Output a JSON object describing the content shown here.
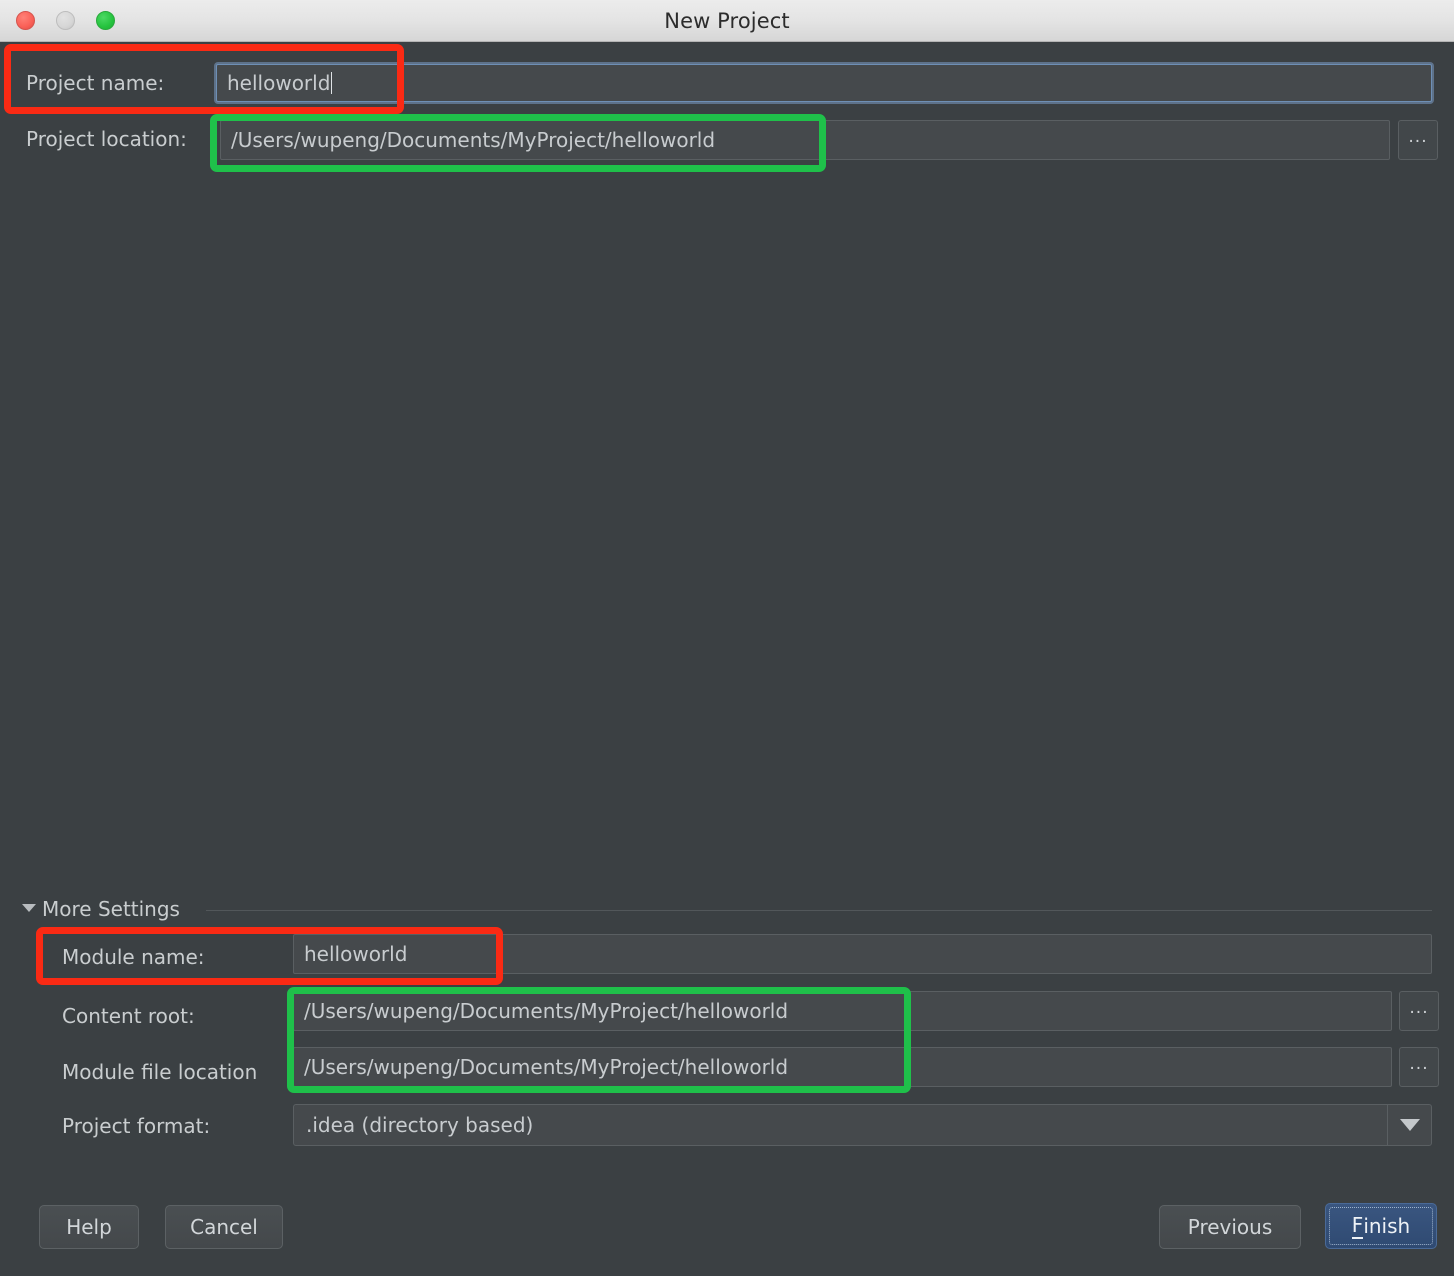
{
  "window": {
    "title": "New Project",
    "traffic_lights": [
      "close-button",
      "minimize-button",
      "maximize-button"
    ]
  },
  "form": {
    "project_name": {
      "label": "Project name:",
      "value": "helloworld",
      "focused": true
    },
    "project_location": {
      "label": "Project location:",
      "value": "/Users/wupeng/Documents/MyProject/helloworld",
      "browse_label": "..."
    }
  },
  "more_settings": {
    "label": "More Settings",
    "expanded": true,
    "module_name": {
      "label": "Module name:",
      "value": "helloworld"
    },
    "content_root": {
      "label": "Content root:",
      "value": "/Users/wupeng/Documents/MyProject/helloworld",
      "browse_label": "..."
    },
    "module_file_location": {
      "label": "Module file location",
      "value": "/Users/wupeng/Documents/MyProject/helloworld",
      "browse_label": "..."
    },
    "project_format": {
      "label": "Project format:",
      "value": ".idea (directory based)"
    }
  },
  "footer": {
    "help": "Help",
    "cancel": "Cancel",
    "previous": "Previous",
    "finish_mnemonic": "F",
    "finish_rest": "inish"
  },
  "colors": {
    "background": "#3b4043",
    "titlebar": "#e4e4e4",
    "field_background": "#45494c",
    "text": "#c9cdcf",
    "accent_primary": "#3a5680",
    "annotation_red": "#fa2a14",
    "annotation_green": "#1fc04a"
  },
  "annotations": [
    {
      "name": "project-name-highlight",
      "color": "red"
    },
    {
      "name": "project-location-highlight",
      "color": "green"
    },
    {
      "name": "module-name-highlight",
      "color": "red"
    },
    {
      "name": "content-root-and-module-file-highlight",
      "color": "green"
    }
  ]
}
